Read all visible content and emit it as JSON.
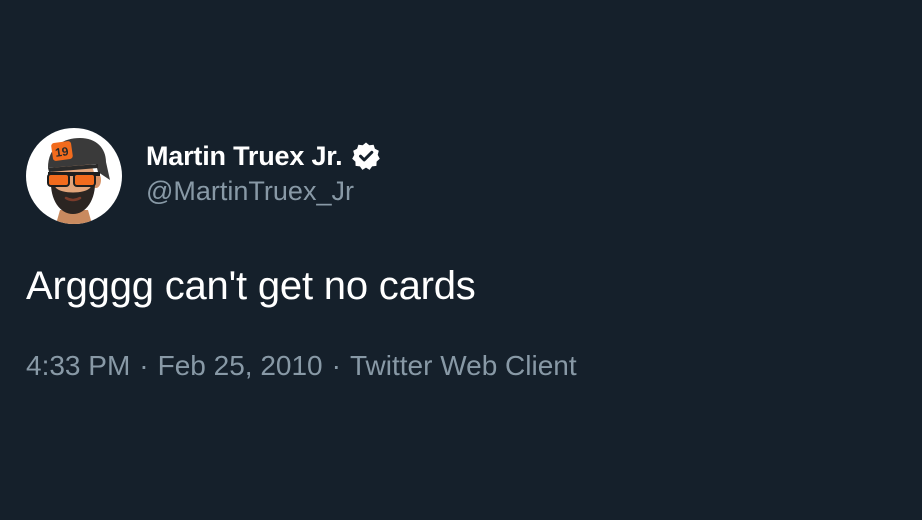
{
  "theme": {
    "background": "#15202b",
    "primary_text": "#ffffff",
    "secondary_text": "#8899a6",
    "avatar_accent": "#f26b1d"
  },
  "author": {
    "display_name": "Martin Truex Jr.",
    "handle": "@MartinTruex_Jr",
    "verified": true,
    "verified_icon": "verified-badge-icon",
    "avatar_icon": "cartoon-driver-avatar-icon",
    "avatar_hat_number": "19"
  },
  "tweet": {
    "text": "Argggg can't get no cards"
  },
  "meta": {
    "time": "4:33 PM",
    "separator": "·",
    "date": "Feb 25, 2010",
    "source": "Twitter Web Client"
  }
}
